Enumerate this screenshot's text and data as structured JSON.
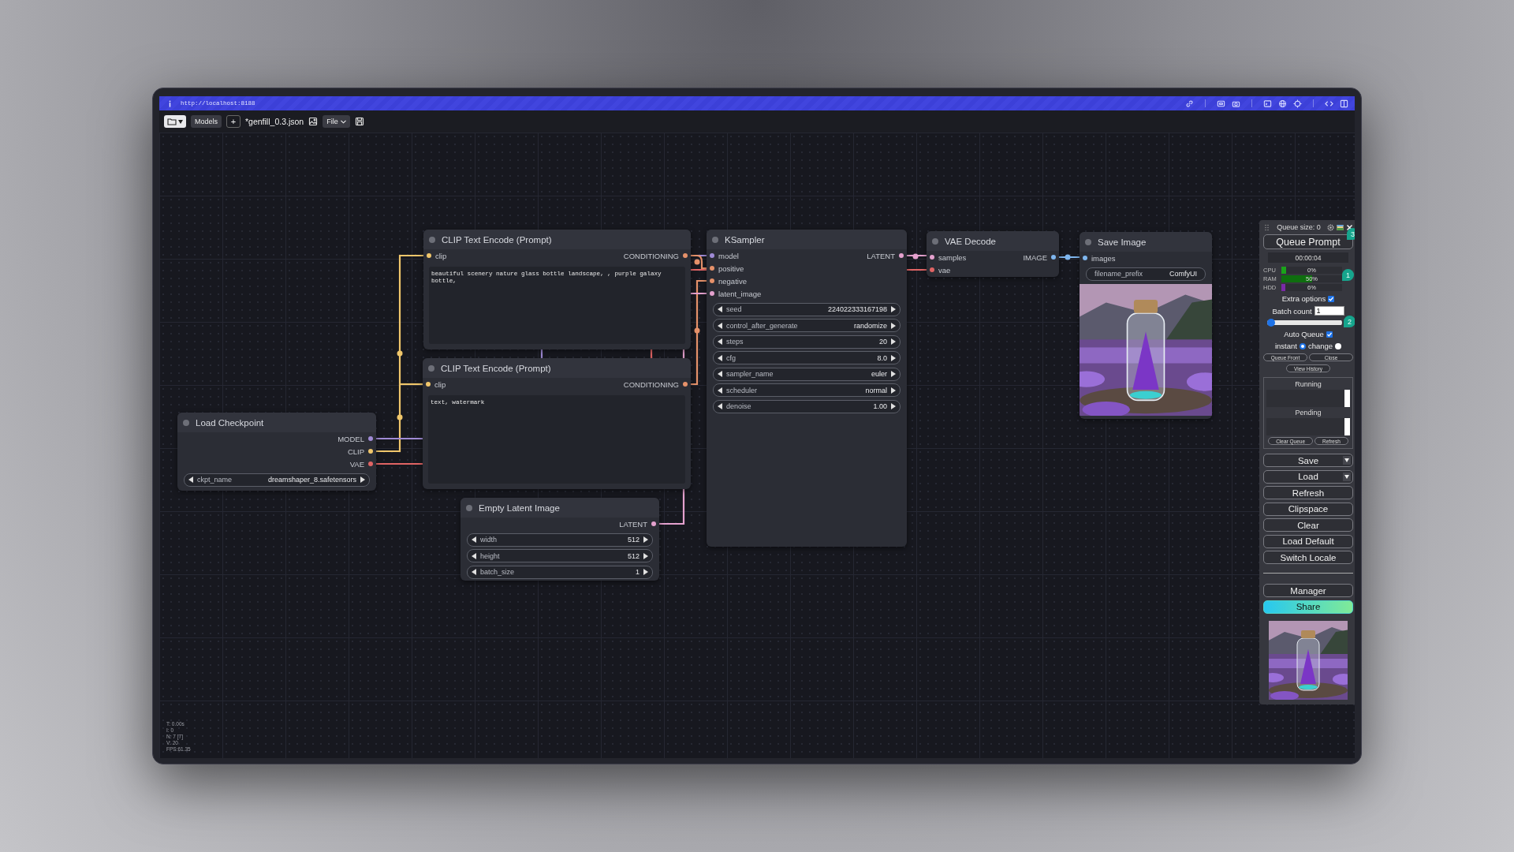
{
  "browser_bar": {
    "url": "http://localhost:8188"
  },
  "toolbar": {
    "models_button": "Models",
    "add_button": "+",
    "workflow_name": "*genfill_0.3.json",
    "file_menu": "File"
  },
  "nodes": [
    {
      "title": "CLIP Text Encode (Prompt)",
      "inputs": [
        {
          "name": "clip",
          "color": "#f0c66b"
        }
      ],
      "outputs": [
        {
          "name": "CONDITIONING",
          "color": "#e5916a"
        }
      ],
      "prompt": "beautiful scenery nature glass bottle landscape, , purple galaxy bottle,"
    },
    {
      "title": "CLIP Text Encode (Prompt)",
      "inputs": [
        {
          "name": "clip",
          "color": "#f0c66b"
        }
      ],
      "outputs": [
        {
          "name": "CONDITIONING",
          "color": "#e5916a"
        }
      ],
      "prompt": "text, watermark"
    },
    {
      "title": "Load Checkpoint",
      "outputs": [
        {
          "name": "MODEL",
          "color": "#a08bd6"
        },
        {
          "name": "CLIP",
          "color": "#f0c66b"
        },
        {
          "name": "VAE",
          "color": "#e06464"
        }
      ],
      "widgets": [
        {
          "kind": "combo",
          "name": "ckpt_name",
          "value": "dreamshaper_8.safetensors"
        }
      ]
    },
    {
      "title": "Empty Latent Image",
      "outputs": [
        {
          "name": "LATENT",
          "color": "#e4a1ce"
        }
      ],
      "widgets": [
        {
          "kind": "number",
          "name": "width",
          "value": "512"
        },
        {
          "kind": "number",
          "name": "height",
          "value": "512"
        },
        {
          "kind": "number",
          "name": "batch_size",
          "value": "1"
        }
      ]
    },
    {
      "title": "KSampler",
      "inputs": [
        {
          "name": "model",
          "color": "#a08bd6"
        },
        {
          "name": "positive",
          "color": "#e5916a"
        },
        {
          "name": "negative",
          "color": "#e5916a"
        },
        {
          "name": "latent_image",
          "color": "#e4a1ce"
        }
      ],
      "outputs": [
        {
          "name": "LATENT",
          "color": "#e4a1ce"
        }
      ],
      "widgets": [
        {
          "kind": "number",
          "name": "seed",
          "value": "224022333167198"
        },
        {
          "kind": "combo",
          "name": "control_after_generate",
          "value": "randomize"
        },
        {
          "kind": "number",
          "name": "steps",
          "value": "20"
        },
        {
          "kind": "number",
          "name": "cfg",
          "value": "8.0"
        },
        {
          "kind": "combo",
          "name": "sampler_name",
          "value": "euler"
        },
        {
          "kind": "combo",
          "name": "scheduler",
          "value": "normal"
        },
        {
          "kind": "number",
          "name": "denoise",
          "value": "1.00"
        }
      ]
    },
    {
      "title": "VAE Decode",
      "inputs": [
        {
          "name": "samples",
          "color": "#e4a1ce"
        },
        {
          "name": "vae",
          "color": "#e06464"
        }
      ],
      "outputs": [
        {
          "name": "IMAGE",
          "color": "#7fb6ee"
        }
      ]
    },
    {
      "title": "Save Image",
      "inputs": [
        {
          "name": "images",
          "color": "#7fb6ee"
        }
      ],
      "widgets": [
        {
          "kind": "text",
          "name": "filename_prefix",
          "value": "ComfyUI"
        }
      ],
      "preview": {
        "kind": "picture"
      }
    }
  ],
  "queue_panel": {
    "title": "Queue size: 0",
    "queue_button": {
      "label": "Queue Prompt",
      "badge": "3"
    },
    "timer": "00:00:04",
    "monitors": [
      {
        "label": "CPU",
        "reading": "0%",
        "level": 0.08,
        "color": "#1aa31a"
      },
      {
        "label": "RAM",
        "reading": "50%",
        "level": 0.5,
        "color": "#0f6e0f"
      },
      {
        "label": "HDD",
        "reading": "6%",
        "level": 0.06,
        "color": "#7a2aa8"
      }
    ],
    "monitors_badge": "1",
    "extra_options": {
      "label": "Extra options",
      "checked": true
    },
    "batch_count": {
      "label": "Batch count",
      "value": "1"
    },
    "batch_slider": {
      "level": 0,
      "badge": "2"
    },
    "auto_queue": {
      "label": "Auto Queue",
      "checked": true
    },
    "modes": [
      {
        "label": "instant",
        "selected": true
      },
      {
        "label": "change",
        "selected": false
      }
    ],
    "small_buttons": [
      "Queue Front",
      "Close"
    ],
    "history_button": "View History",
    "queue_sections": [
      "Running",
      "Pending"
    ],
    "queue_buttons": [
      "Clear Queue",
      "Refresh"
    ],
    "menu_buttons": [
      {
        "label": "Save",
        "dropdown": true
      },
      {
        "label": "Load",
        "dropdown": true
      },
      {
        "label": "Refresh",
        "dropdown": false
      },
      {
        "label": "Clipspace",
        "dropdown": false
      },
      {
        "label": "Clear",
        "dropdown": false
      },
      {
        "label": "Load Default",
        "dropdown": false
      },
      {
        "label": "Switch Locale",
        "dropdown": false
      }
    ],
    "extra_buttons": [
      {
        "label": "Manager",
        "kind": "plain"
      },
      {
        "label": "Share",
        "kind": "gradient"
      }
    ],
    "thumbnail": {
      "kind": "picture"
    }
  },
  "stats": [
    "T: 0.00s",
    "I: 0",
    "N: 7 [7]",
    "V: 20",
    "FPS:61.35"
  ]
}
